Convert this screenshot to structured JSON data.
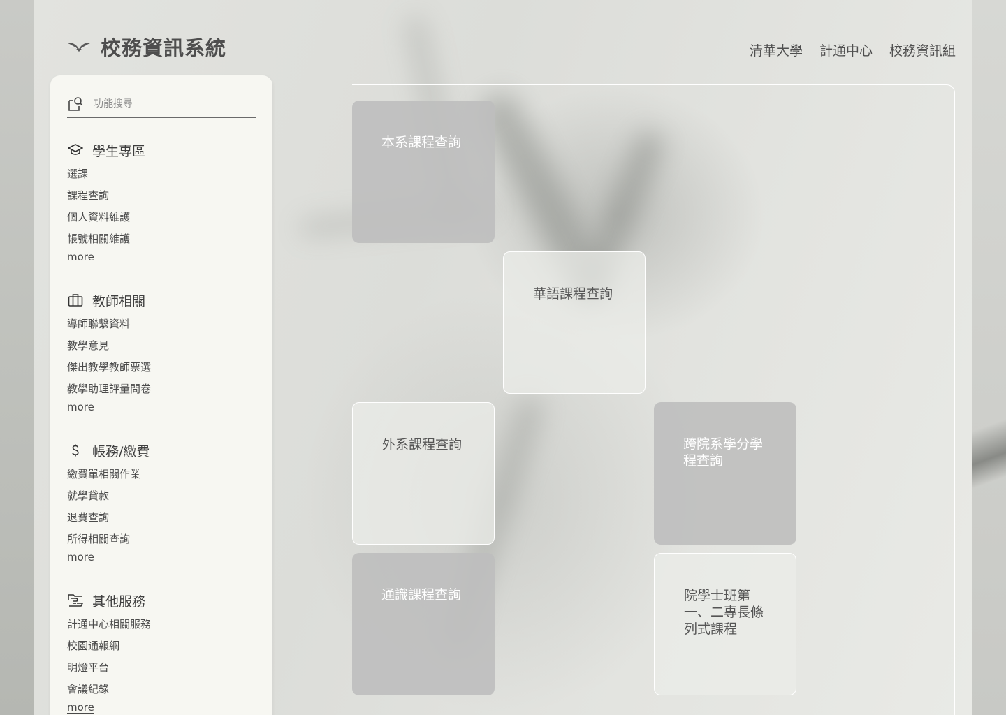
{
  "header": {
    "title": "校務資訊系統",
    "nav": [
      "清華大學",
      "計通中心",
      "校務資訊組"
    ]
  },
  "sidebar": {
    "search_placeholder": "功能搜尋",
    "sections": [
      {
        "title": "學生專區",
        "icon": "graduation-cap-icon",
        "items": [
          "選課",
          "課程查詢",
          "個人資料維護",
          "帳號相關維護"
        ],
        "more": "more"
      },
      {
        "title": "教師相關",
        "icon": "briefcase-icon",
        "items": [
          "導師聯繫資料",
          "教學意見",
          "傑出教學教師票選",
          "教學助理評量問卷"
        ],
        "more": "more"
      },
      {
        "title": "帳務/繳費",
        "icon": "dollar-icon",
        "items": [
          "繳費單相關作業",
          "就學貸款",
          "退費查詢",
          "所得相關查詢"
        ],
        "more": "more"
      },
      {
        "title": "其他服務",
        "icon": "hand-service-icon",
        "items": [
          "計通中心相關服務",
          "校園通報網",
          "明燈平台",
          "會議紀錄"
        ],
        "more": "more"
      }
    ]
  },
  "cards": [
    {
      "label": "本系課程查詢",
      "style": "dark"
    },
    {
      "label": "華語課程查詢",
      "style": "light"
    },
    {
      "label": "外系課程查詢",
      "style": "light"
    },
    {
      "label": "跨院系學分學程查詢",
      "style": "dark"
    },
    {
      "label": "通識課程查詢",
      "style": "dark"
    },
    {
      "label": "院學士班第一、二專長條列式課程",
      "style": "light"
    }
  ],
  "colors": {
    "sidebar_bg": "#f7f7f2",
    "card_dark": "#bebebe",
    "card_light": "#ebece8",
    "text": "#4a4a4a"
  }
}
